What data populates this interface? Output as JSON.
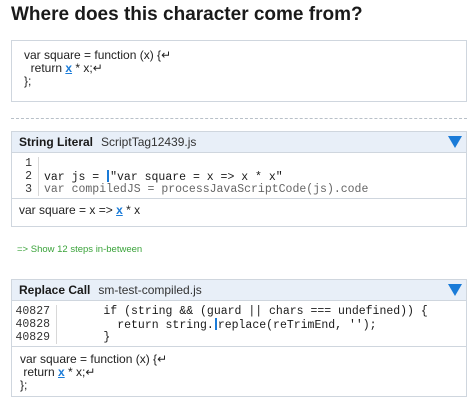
{
  "heading": "Where does this character come from?",
  "origin_snippet": {
    "lines": [
      {
        "pre": "var square = function (x) {↵",
        "hl": "",
        "post": ""
      },
      {
        "pre": "  return ",
        "hl": "x",
        "post": " * x;↵"
      },
      {
        "pre": "};",
        "hl": "",
        "post": ""
      }
    ]
  },
  "steps": [
    {
      "type": "String Literal",
      "file": "ScriptTag12439.js",
      "code": [
        {
          "ln": "1",
          "before": "",
          "cursor": false,
          "after": "",
          "dim": false
        },
        {
          "ln": "2",
          "before": "var js = ",
          "cursor": true,
          "after": "\"var square = x => x * x\"",
          "dim": false
        },
        {
          "ln": "3",
          "before": "var compiledJS = processJavaScriptCode(js).code",
          "cursor": false,
          "after": "",
          "dim": true
        }
      ],
      "result": {
        "pre": "var square = x => ",
        "hl": "x",
        "post": " * x"
      }
    },
    {
      "type": "Replace Call",
      "file": "sm-test-compiled.js",
      "code": [
        {
          "ln": "40827",
          "before": "      if (string && (guard || chars === undefined)) {",
          "cursor": false,
          "after": "",
          "dim": false
        },
        {
          "ln": "40828",
          "before": "        return string.",
          "cursor": true,
          "after": "replace(reTrimEnd, '');",
          "dim": false
        },
        {
          "ln": "40829",
          "before": "      }",
          "cursor": false,
          "after": "",
          "dim": false
        }
      ],
      "result_lines": [
        {
          "pre": "var square = function (x) {↵",
          "hl": "",
          "post": ""
        },
        {
          "pre": " return ",
          "hl": "x",
          "post": " * x;↵"
        },
        {
          "pre": "};",
          "hl": "",
          "post": ""
        }
      ]
    }
  ],
  "show_steps_link": "=> Show 12 steps in-between",
  "expand_icon": "triangle-down-icon",
  "colors": {
    "accent": "#1a7bd8",
    "link_green": "#3aa33a",
    "header_bg": "#e8eff8"
  }
}
